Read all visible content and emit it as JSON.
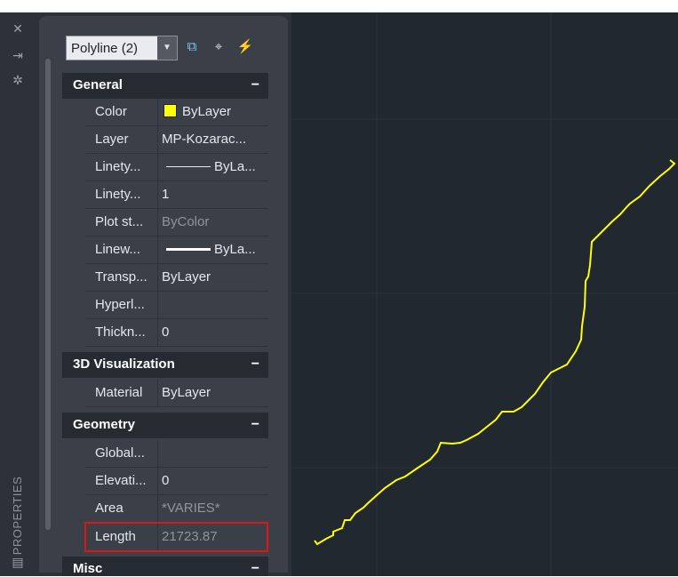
{
  "control_strip": {
    "close_icon": "close-icon",
    "autohide_icon": "auto-hide-icon",
    "properties_menu_icon": "properties-menu-icon",
    "title": "PROPERTIES",
    "title_icon": "properties-icon"
  },
  "toolbar": {
    "object_type": "Polyline (2)",
    "toggle_pickadd_icon": "toggle-pickadd-icon",
    "select_objects_icon": "select-objects-icon",
    "quick_select_icon": "quick-select-icon"
  },
  "sections": {
    "general": {
      "title": "General",
      "collapse": "−",
      "rows": [
        {
          "name": "Color",
          "value": "ByLayer"
        },
        {
          "name": "Layer",
          "value": "MP-Kozarac..."
        },
        {
          "name": "Linety...",
          "value": "ByLa..."
        },
        {
          "name": "Linety...",
          "value": "1"
        },
        {
          "name": "Plot st...",
          "value": "ByColor"
        },
        {
          "name": "Linew...",
          "value": "ByLa..."
        },
        {
          "name": "Transp...",
          "value": "ByLayer"
        },
        {
          "name": "Hyperl...",
          "value": ""
        },
        {
          "name": "Thickn...",
          "value": "0"
        }
      ]
    },
    "visualization": {
      "title": "3D Visualization",
      "collapse": "−",
      "rows": [
        {
          "name": "Material",
          "value": "ByLayer"
        }
      ]
    },
    "geometry": {
      "title": "Geometry",
      "collapse": "−",
      "rows": [
        {
          "name": "Global...",
          "value": ""
        },
        {
          "name": "Elevati...",
          "value": "0"
        },
        {
          "name": "Area",
          "value": "*VARIES*"
        },
        {
          "name": "Length",
          "value": "21723.87"
        }
      ]
    },
    "misc": {
      "title": "Misc",
      "collapse": "−"
    }
  },
  "colors": {
    "polyline": "#ffff00",
    "highlight_box": "#e0151a",
    "canvas_bg": "#212830"
  }
}
